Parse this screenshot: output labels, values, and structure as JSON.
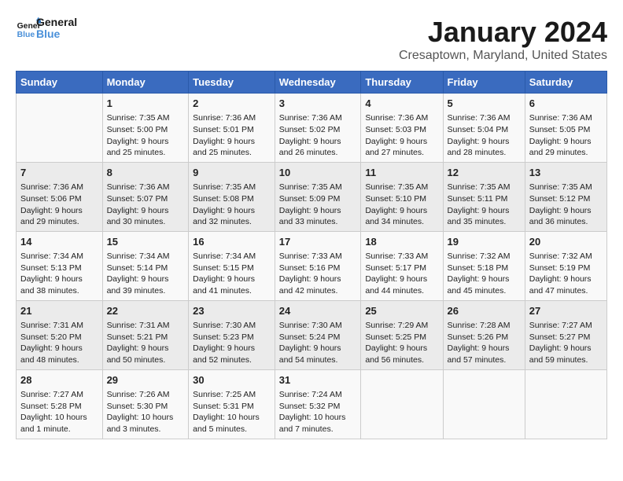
{
  "logo": {
    "line1": "General",
    "line2": "Blue"
  },
  "title": "January 2024",
  "location": "Cresaptown, Maryland, United States",
  "headers": [
    "Sunday",
    "Monday",
    "Tuesday",
    "Wednesday",
    "Thursday",
    "Friday",
    "Saturday"
  ],
  "weeks": [
    [
      {
        "day": "",
        "info": ""
      },
      {
        "day": "1",
        "info": "Sunrise: 7:35 AM\nSunset: 5:00 PM\nDaylight: 9 hours\nand 25 minutes."
      },
      {
        "day": "2",
        "info": "Sunrise: 7:36 AM\nSunset: 5:01 PM\nDaylight: 9 hours\nand 25 minutes."
      },
      {
        "day": "3",
        "info": "Sunrise: 7:36 AM\nSunset: 5:02 PM\nDaylight: 9 hours\nand 26 minutes."
      },
      {
        "day": "4",
        "info": "Sunrise: 7:36 AM\nSunset: 5:03 PM\nDaylight: 9 hours\nand 27 minutes."
      },
      {
        "day": "5",
        "info": "Sunrise: 7:36 AM\nSunset: 5:04 PM\nDaylight: 9 hours\nand 28 minutes."
      },
      {
        "day": "6",
        "info": "Sunrise: 7:36 AM\nSunset: 5:05 PM\nDaylight: 9 hours\nand 29 minutes."
      }
    ],
    [
      {
        "day": "7",
        "info": "Sunrise: 7:36 AM\nSunset: 5:06 PM\nDaylight: 9 hours\nand 29 minutes."
      },
      {
        "day": "8",
        "info": "Sunrise: 7:36 AM\nSunset: 5:07 PM\nDaylight: 9 hours\nand 30 minutes."
      },
      {
        "day": "9",
        "info": "Sunrise: 7:35 AM\nSunset: 5:08 PM\nDaylight: 9 hours\nand 32 minutes."
      },
      {
        "day": "10",
        "info": "Sunrise: 7:35 AM\nSunset: 5:09 PM\nDaylight: 9 hours\nand 33 minutes."
      },
      {
        "day": "11",
        "info": "Sunrise: 7:35 AM\nSunset: 5:10 PM\nDaylight: 9 hours\nand 34 minutes."
      },
      {
        "day": "12",
        "info": "Sunrise: 7:35 AM\nSunset: 5:11 PM\nDaylight: 9 hours\nand 35 minutes."
      },
      {
        "day": "13",
        "info": "Sunrise: 7:35 AM\nSunset: 5:12 PM\nDaylight: 9 hours\nand 36 minutes."
      }
    ],
    [
      {
        "day": "14",
        "info": "Sunrise: 7:34 AM\nSunset: 5:13 PM\nDaylight: 9 hours\nand 38 minutes."
      },
      {
        "day": "15",
        "info": "Sunrise: 7:34 AM\nSunset: 5:14 PM\nDaylight: 9 hours\nand 39 minutes."
      },
      {
        "day": "16",
        "info": "Sunrise: 7:34 AM\nSunset: 5:15 PM\nDaylight: 9 hours\nand 41 minutes."
      },
      {
        "day": "17",
        "info": "Sunrise: 7:33 AM\nSunset: 5:16 PM\nDaylight: 9 hours\nand 42 minutes."
      },
      {
        "day": "18",
        "info": "Sunrise: 7:33 AM\nSunset: 5:17 PM\nDaylight: 9 hours\nand 44 minutes."
      },
      {
        "day": "19",
        "info": "Sunrise: 7:32 AM\nSunset: 5:18 PM\nDaylight: 9 hours\nand 45 minutes."
      },
      {
        "day": "20",
        "info": "Sunrise: 7:32 AM\nSunset: 5:19 PM\nDaylight: 9 hours\nand 47 minutes."
      }
    ],
    [
      {
        "day": "21",
        "info": "Sunrise: 7:31 AM\nSunset: 5:20 PM\nDaylight: 9 hours\nand 48 minutes."
      },
      {
        "day": "22",
        "info": "Sunrise: 7:31 AM\nSunset: 5:21 PM\nDaylight: 9 hours\nand 50 minutes."
      },
      {
        "day": "23",
        "info": "Sunrise: 7:30 AM\nSunset: 5:23 PM\nDaylight: 9 hours\nand 52 minutes."
      },
      {
        "day": "24",
        "info": "Sunrise: 7:30 AM\nSunset: 5:24 PM\nDaylight: 9 hours\nand 54 minutes."
      },
      {
        "day": "25",
        "info": "Sunrise: 7:29 AM\nSunset: 5:25 PM\nDaylight: 9 hours\nand 56 minutes."
      },
      {
        "day": "26",
        "info": "Sunrise: 7:28 AM\nSunset: 5:26 PM\nDaylight: 9 hours\nand 57 minutes."
      },
      {
        "day": "27",
        "info": "Sunrise: 7:27 AM\nSunset: 5:27 PM\nDaylight: 9 hours\nand 59 minutes."
      }
    ],
    [
      {
        "day": "28",
        "info": "Sunrise: 7:27 AM\nSunset: 5:28 PM\nDaylight: 10 hours\nand 1 minute."
      },
      {
        "day": "29",
        "info": "Sunrise: 7:26 AM\nSunset: 5:30 PM\nDaylight: 10 hours\nand 3 minutes."
      },
      {
        "day": "30",
        "info": "Sunrise: 7:25 AM\nSunset: 5:31 PM\nDaylight: 10 hours\nand 5 minutes."
      },
      {
        "day": "31",
        "info": "Sunrise: 7:24 AM\nSunset: 5:32 PM\nDaylight: 10 hours\nand 7 minutes."
      },
      {
        "day": "",
        "info": ""
      },
      {
        "day": "",
        "info": ""
      },
      {
        "day": "",
        "info": ""
      }
    ]
  ]
}
